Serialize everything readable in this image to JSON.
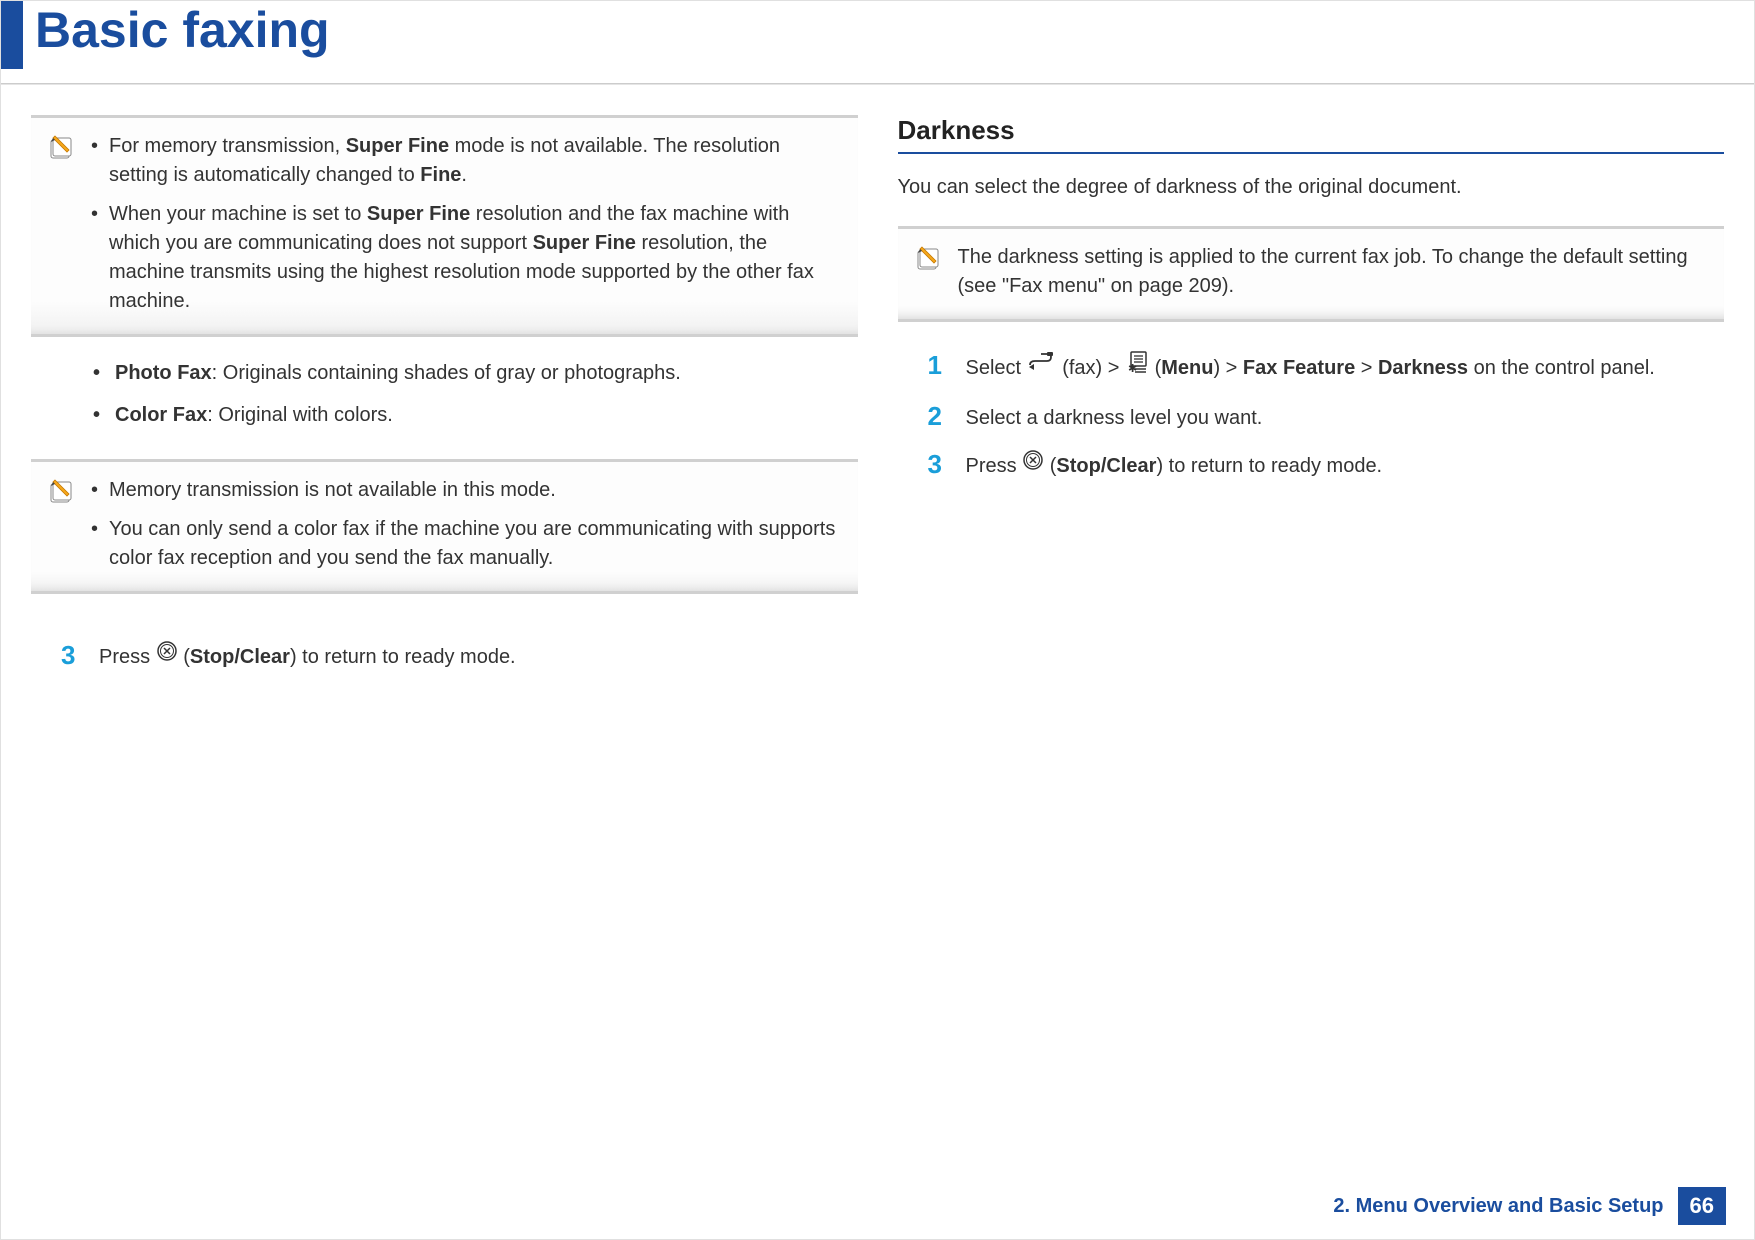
{
  "page_title": "Basic faxing",
  "left_column": {
    "note1": {
      "bullets": [
        "For memory transmission, <b>Super Fine</b> mode is not available. The resolution setting is automatically changed to <b>Fine</b>.",
        "When your machine is set to <b>Super Fine</b> resolution and the fax machine with which you are communicating does not support <b>Super Fine</b> resolution, the machine transmits using the highest resolution mode supported by the other fax machine."
      ]
    },
    "bullets": [
      "<b>Photo Fax</b>: Originals containing shades of gray or photographs.",
      "<b>Color Fax</b>: Original with colors."
    ],
    "note2": {
      "bullets": [
        "Memory transmission is not available in this mode.",
        "You can only send a color fax if the machine you are communicating with supports color fax reception and you send the fax manually."
      ]
    },
    "step3": {
      "num": "3",
      "prefix": "Press ",
      "button": "Stop/Clear",
      "suffix": ") to return to ready mode."
    }
  },
  "right_column": {
    "heading": "Darkness",
    "intro": "You can select the degree of darkness of the original document.",
    "note": {
      "text": "The darkness setting is applied to the current fax job. To change the default setting (see \"Fax menu\" on page 209)."
    },
    "step1": {
      "num": "1",
      "prefix": "Select ",
      "fax_label": "(fax) > ",
      "menu_label": "Menu",
      "mid": ") > ",
      "feature": "Fax Feature",
      "gt": " > ",
      "darkness": "Darkness",
      "suffix": " on the control panel."
    },
    "step2": {
      "num": "2",
      "text": "Select a darkness level you want."
    },
    "step3": {
      "num": "3",
      "prefix": "Press ",
      "button": "Stop/Clear",
      "suffix": ") to return to ready mode."
    }
  },
  "footer": {
    "chapter": "2. Menu Overview and Basic Setup",
    "page": "66"
  }
}
